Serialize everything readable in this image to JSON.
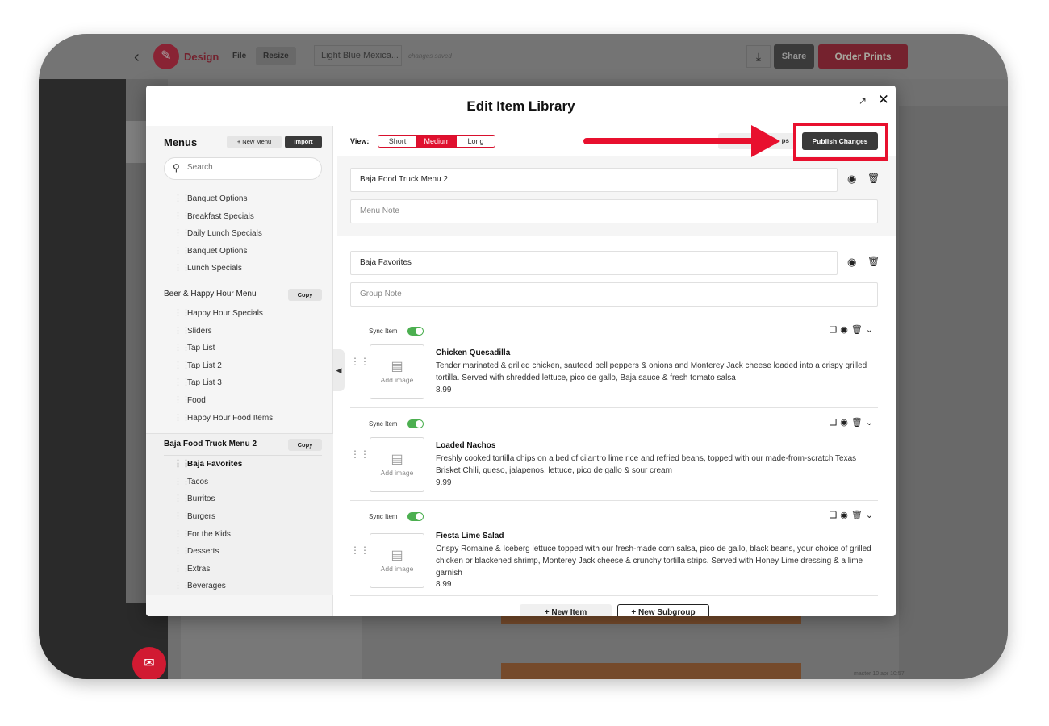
{
  "app": {
    "title": "Design",
    "menu_file": "File",
    "menu_resize": "Resize",
    "doc_name": "Light Blue Mexica...",
    "save_status": "changes saved",
    "share": "Share",
    "order_prints": "Order Prints",
    "footer_meta": "master 10 apr 10:57"
  },
  "modal": {
    "title": "Edit Item Library",
    "sidebar": {
      "title": "Menus",
      "new_menu": "+ New Menu",
      "import": "Import",
      "search_placeholder": "Search",
      "copy_label": "Copy",
      "group1": [
        "Banquet Options",
        "Breakfast Specials",
        "Daily Lunch Specials",
        "Banquet Options",
        "Lunch Specials"
      ],
      "menu2": "Beer & Happy Hour Menu",
      "group2": [
        "Happy Hour Specials",
        "Sliders",
        "Tap List",
        "Tap List 2",
        "Tap List 3",
        "Food",
        "Happy Hour Food Items"
      ],
      "menu3": "Baja Food Truck Menu 2",
      "group3": [
        "Baja Favorites",
        "Tacos",
        "Burritos",
        "Burgers",
        "For the Kids",
        "Desserts",
        "Extras",
        "Beverages"
      ]
    },
    "toolbar": {
      "view_label": "View:",
      "views": [
        "Short",
        "Medium",
        "Long"
      ],
      "ghost_label": "ps",
      "publish": "Publish Changes"
    },
    "menu_name": "Baja Food Truck Menu 2",
    "menu_note_placeholder": "Menu Note",
    "group_name": "Baja Favorites",
    "group_note_placeholder": "Group Note",
    "sync_label": "Sync Item",
    "add_image": "Add image",
    "items": [
      {
        "name": "Chicken Quesadilla",
        "desc": "Tender marinated & grilled chicken, sauteed bell peppers & onions and Monterey Jack cheese loaded into a crispy grilled tortilla. Served with shredded lettuce, pico de gallo, Baja sauce & fresh tomato salsa",
        "price": "8.99"
      },
      {
        "name": "Loaded Nachos",
        "desc": "Freshly cooked tortilla chips on a bed of cilantro lime rice and refried beans, topped with our made-from-scratch Texas Brisket Chili, queso, jalapenos, lettuce, pico de gallo & sour cream",
        "price": "9.99"
      },
      {
        "name": "Fiesta Lime Salad",
        "desc": "Crispy Romaine & Iceberg lettuce topped with our fresh-made corn salsa, pico de gallo, black beans, your choice of grilled chicken or blackened shrimp, Monterey Jack cheese & crunchy tortilla strips. Served with Honey Lime dressing & a lime garnish",
        "price": "8.99"
      }
    ],
    "new_item": "+ New Item",
    "new_subgroup": "+ New Subgroup"
  },
  "colors": {
    "brand": "#e0102e",
    "dark_button": "#3a3a3a",
    "toggle_on": "#4caf50"
  }
}
